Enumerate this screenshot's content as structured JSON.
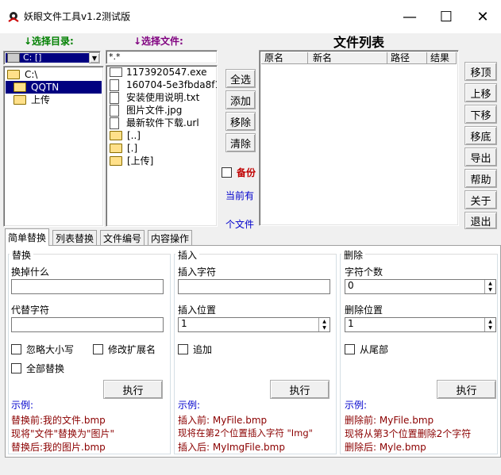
{
  "window": {
    "title": "妖眼文件工具v1.2测试版",
    "min": "—",
    "max": "☐",
    "close": "✕"
  },
  "left": {
    "dir_label": "↓选择目录:",
    "file_label": "↓选择文件:",
    "drive_value": "C: []",
    "dirs": [
      "C:\\",
      "QQTN",
      "上传"
    ],
    "file_filter": "*.*",
    "files": [
      "1173920547.exe",
      "160704-5e3fbda8f11fb.jpg",
      "安装使用说明.txt",
      "图片文件.jpg",
      "最新软件下载.url"
    ],
    "folders": [
      "[..]",
      "[.]",
      "[上传]"
    ]
  },
  "mid": {
    "buttons": [
      "全选",
      "添加",
      "移除",
      "清除"
    ],
    "backup_label": "备份",
    "current_label": "当前有",
    "count_label": "个文件"
  },
  "list": {
    "title": "文件列表",
    "columns": [
      "原名",
      "新名",
      "路径",
      "结果"
    ]
  },
  "right_buttons": [
    "移顶",
    "上移",
    "下移",
    "移底",
    "导出",
    "帮助",
    "关于",
    "退出"
  ],
  "tabs": [
    "简单替换",
    "列表替换",
    "文件编号",
    "内容操作"
  ],
  "replace": {
    "group": "替换",
    "find_label": "换掉什么",
    "find_value": "",
    "repl_label": "代替字符",
    "repl_value": "",
    "ignore_case": "忽略大小写",
    "change_ext": "修改扩展名",
    "replace_all": "全部替换",
    "exec": "执行",
    "example": "示例:",
    "line1": "替换前:我的文件.bmp",
    "line2": "现将\"文件\"替换为\"图片\"",
    "line3": "替换后:我的图片.bmp"
  },
  "insert": {
    "group": "插入",
    "chars_label": "插入字符",
    "chars_value": "",
    "pos_label": "插入位置",
    "pos_value": "1",
    "append": "追加",
    "exec": "执行",
    "example": "示例:",
    "line1": "插入前: MyFile.bmp",
    "line2": "现将在第2个位置插入字符 \"Img\"",
    "line3": "插入后: MyImgFile.bmp"
  },
  "delete": {
    "group": "删除",
    "count_label": "字符个数",
    "count_value": "0",
    "pos_label": "删除位置",
    "pos_value": "1",
    "from_end": "从尾部",
    "exec": "执行",
    "example": "示例:",
    "line1": "删除前: MyFile.bmp",
    "line2": "现将从第3个位置删除2个字符",
    "line3": "删除后: Myle.bmp"
  }
}
